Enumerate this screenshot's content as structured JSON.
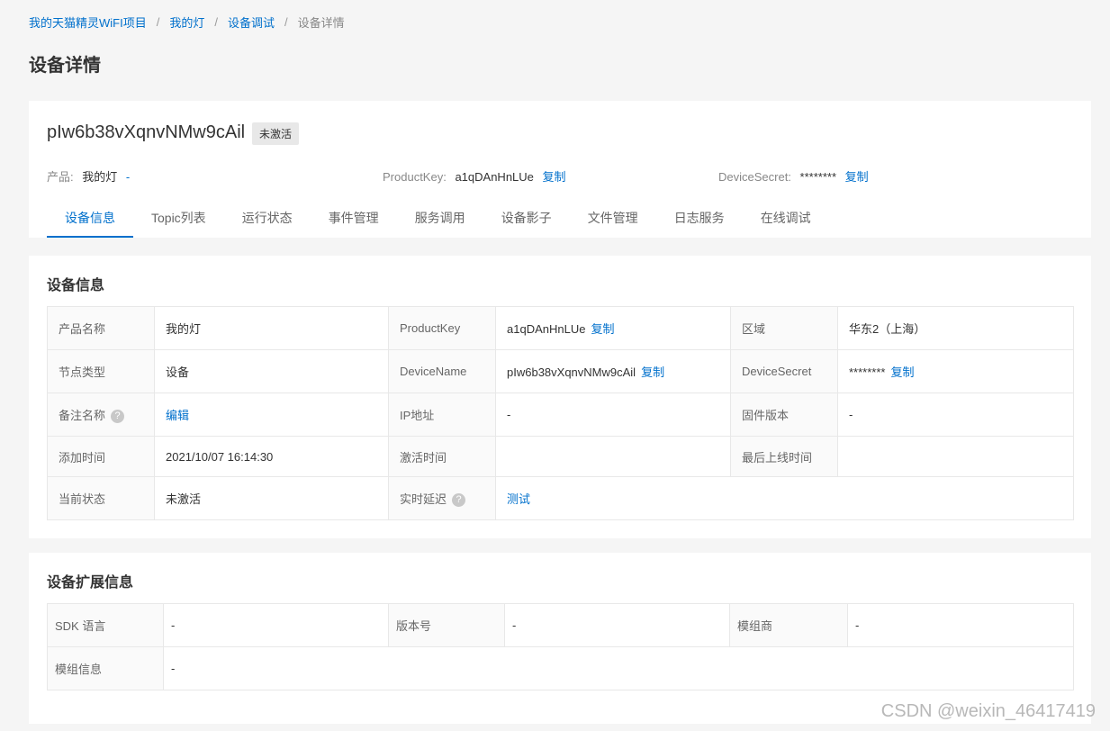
{
  "breadcrumb": {
    "items": [
      "我的天猫精灵WiFI项目",
      "我的灯",
      "设备调试"
    ],
    "current": "设备详情",
    "separator": "/"
  },
  "page_title": "设备详情",
  "device": {
    "name": "pIw6b38vXqnvNMw9cAil",
    "status": "未激活",
    "product_label": "产品:",
    "product_value": "我的灯",
    "product_extra": "-",
    "productkey_label": "ProductKey:",
    "productkey_value": "a1qDAnHnLUe",
    "copy_label": "复制",
    "devicesecret_label": "DeviceSecret:",
    "devicesecret_value": "********"
  },
  "tabs": [
    "设备信息",
    "Topic列表",
    "运行状态",
    "事件管理",
    "服务调用",
    "设备影子",
    "文件管理",
    "日志服务",
    "在线调试"
  ],
  "device_info": {
    "title": "设备信息",
    "rows": [
      [
        {
          "label": "产品名称",
          "value": "我的灯"
        },
        {
          "label": "ProductKey",
          "value": "a1qDAnHnLUe",
          "copy": "复制"
        },
        {
          "label": "区域",
          "value": "华东2（上海）"
        }
      ],
      [
        {
          "label": "节点类型",
          "value": "设备"
        },
        {
          "label": "DeviceName",
          "value": "pIw6b38vXqnvNMw9cAil",
          "copy": "复制"
        },
        {
          "label": "DeviceSecret",
          "value": "********",
          "copy": "复制"
        }
      ],
      [
        {
          "label": "备注名称",
          "value_link": "编辑"
        },
        {
          "label": "IP地址",
          "value": "-"
        },
        {
          "label": "固件版本",
          "value": "-"
        }
      ],
      [
        {
          "label": "添加时间",
          "value": "2021/10/07 16:14:30"
        },
        {
          "label": "激活时间",
          "value": ""
        },
        {
          "label": "最后上线时间",
          "value": ""
        }
      ],
      [
        {
          "label": "当前状态",
          "value": "未激活"
        },
        {
          "label": "实时延迟",
          "value_link": "测试"
        }
      ]
    ]
  },
  "ext_info": {
    "title": "设备扩展信息",
    "rows": [
      [
        {
          "label": "SDK 语言",
          "value": "-"
        },
        {
          "label": "版本号",
          "value": "-"
        },
        {
          "label": "模组商",
          "value": "-"
        }
      ],
      [
        {
          "label": "模组信息",
          "value": "-"
        }
      ]
    ]
  },
  "help_glyph": "?",
  "watermark": "CSDN @weixin_46417419",
  "colors": {
    "link": "#0070cc",
    "background": "#f5f5f5",
    "label_bg": "#fafafa",
    "tag_bg": "#e8e8e8"
  }
}
